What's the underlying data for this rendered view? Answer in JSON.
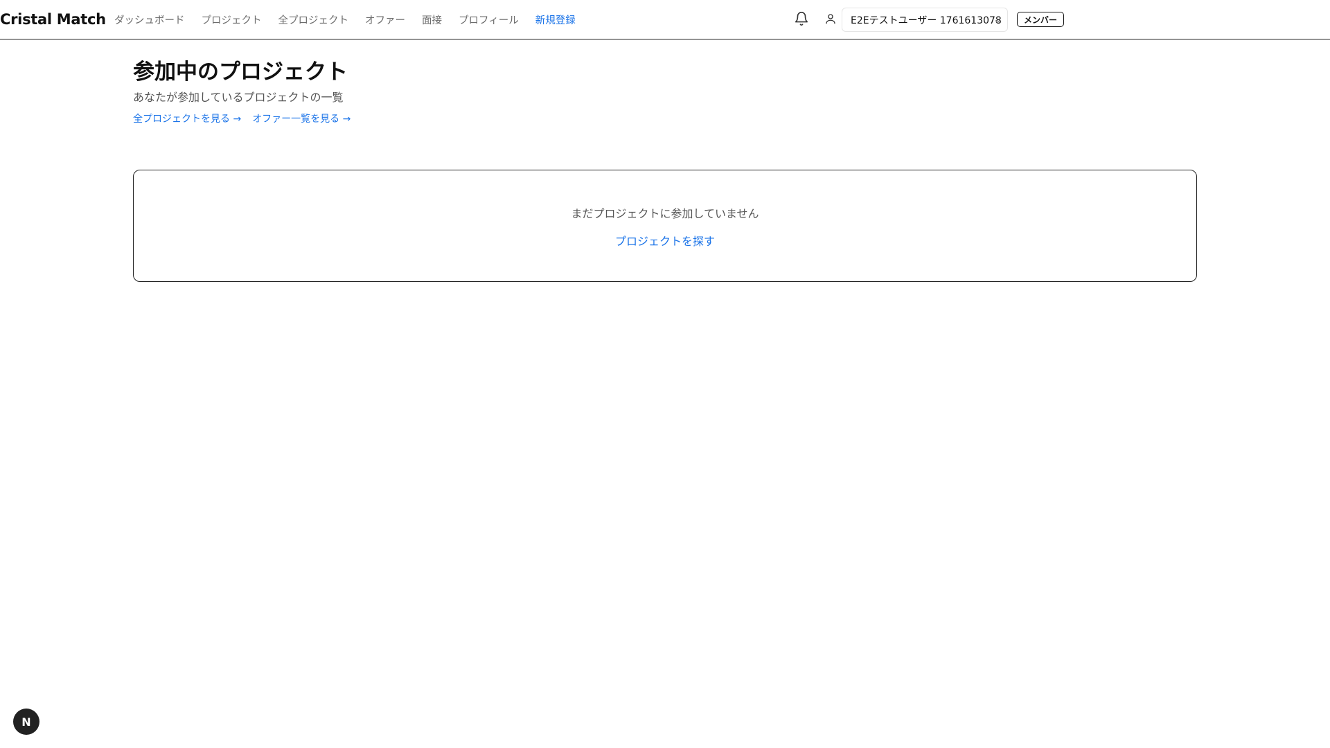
{
  "app": {
    "brand": "Cristal Match"
  },
  "nav": {
    "items": [
      {
        "label": "ダッシュボード"
      },
      {
        "label": "プロジェクト"
      },
      {
        "label": "全プロジェクト"
      },
      {
        "label": "オファー"
      },
      {
        "label": "面接"
      },
      {
        "label": "プロフィール"
      },
      {
        "label": "新規登録"
      }
    ]
  },
  "header": {
    "notification_icon": "bell-icon",
    "user_icon": "user-icon",
    "user_select_value": "E2Eテストユーザー 1761613078",
    "role_badge": "メンバー"
  },
  "page": {
    "title": "参加中のプロジェクト",
    "subtitle": "あなたが参加しているプロジェクトの一覧",
    "links": [
      {
        "label": "全プロジェクトを見る →"
      },
      {
        "label": "オファー一覧を見る →"
      }
    ]
  },
  "empty_state": {
    "message": "まだプロジェクトに参加していません",
    "action_label": "プロジェクトを探す"
  },
  "dev_badge": {
    "label": "N"
  },
  "colors": {
    "accent": "#1a73e8",
    "text": "#111111",
    "muted": "#6b6b6b",
    "border": "#222222"
  }
}
